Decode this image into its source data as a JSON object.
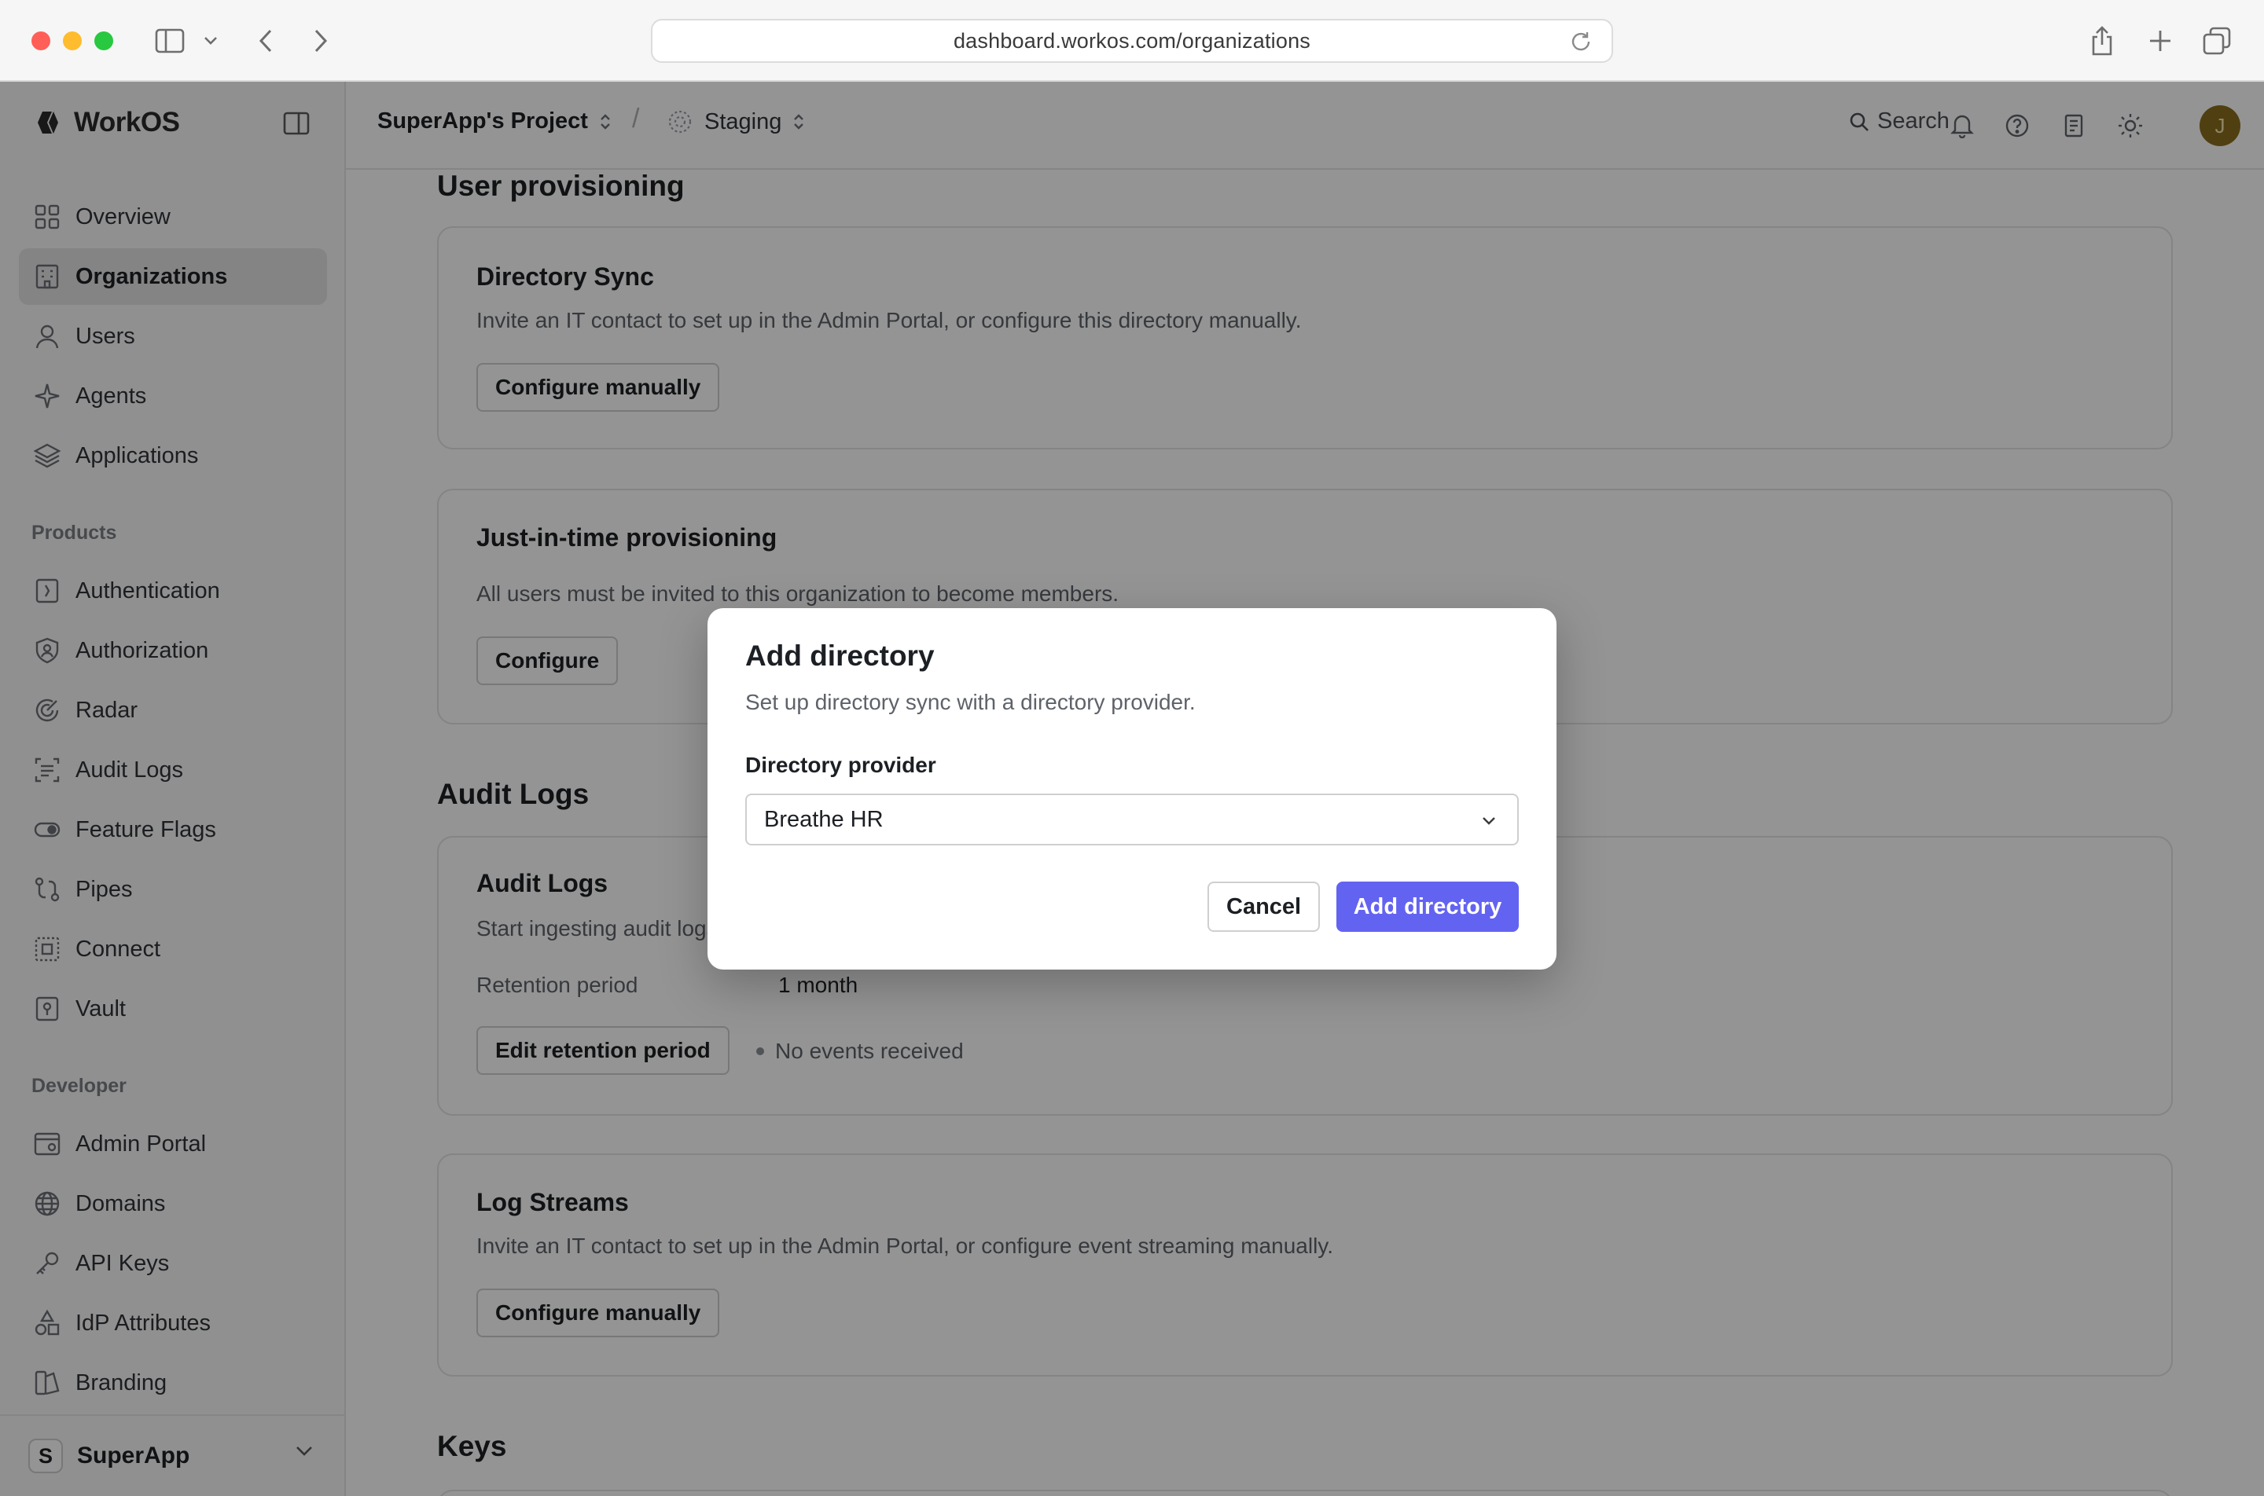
{
  "browser": {
    "url": "dashboard.workos.com/organizations"
  },
  "sidebar": {
    "brand": "WorkOS",
    "items": [
      {
        "label": "Overview",
        "icon": "grid-icon"
      },
      {
        "label": "Organizations",
        "icon": "building-icon",
        "active": true
      },
      {
        "label": "Users",
        "icon": "user-icon"
      },
      {
        "label": "Agents",
        "icon": "sparkle-icon"
      },
      {
        "label": "Applications",
        "icon": "layers-icon"
      }
    ],
    "products_label": "Products",
    "products": [
      {
        "label": "Authentication",
        "icon": "auth-icon"
      },
      {
        "label": "Authorization",
        "icon": "shield-icon"
      },
      {
        "label": "Radar",
        "icon": "radar-icon"
      },
      {
        "label": "Audit Logs",
        "icon": "audit-icon"
      },
      {
        "label": "Feature Flags",
        "icon": "toggle-icon"
      },
      {
        "label": "Pipes",
        "icon": "pipes-icon"
      },
      {
        "label": "Connect",
        "icon": "connect-icon"
      },
      {
        "label": "Vault",
        "icon": "vault-icon"
      }
    ],
    "developer_label": "Developer",
    "developer": [
      {
        "label": "Admin Portal",
        "icon": "portal-icon"
      },
      {
        "label": "Domains",
        "icon": "globe-icon"
      },
      {
        "label": "API Keys",
        "icon": "key-icon"
      },
      {
        "label": "IdP Attributes",
        "icon": "shapes-icon"
      },
      {
        "label": "Branding",
        "icon": "brush-icon"
      }
    ],
    "workspace": {
      "initial": "S",
      "name": "SuperApp"
    }
  },
  "header": {
    "project": "SuperApp's Project",
    "separator": "/",
    "environment": "Staging",
    "search_label": "Search",
    "user_initial": "J"
  },
  "main": {
    "user_provisioning_title": "User provisioning",
    "directory_sync": {
      "title": "Directory Sync",
      "desc": "Invite an IT contact to set up in the Admin Portal, or configure this directory manually.",
      "button": "Configure manually"
    },
    "jit": {
      "title": "Just-in-time provisioning",
      "desc": "All users must be invited to this organization to become members.",
      "button": "Configure"
    },
    "audit_logs_title": "Audit Logs",
    "audit_logs": {
      "title": "Audit Logs",
      "desc": "Start ingesting audit logs",
      "retention_label": "Retention period",
      "retention_value": "1 month",
      "button": "Edit retention period",
      "status": "No events received"
    },
    "log_streams": {
      "title": "Log Streams",
      "desc": "Invite an IT contact to set up in the Admin Portal, or configure event streaming manually.",
      "button": "Configure manually"
    },
    "keys_title": "Keys"
  },
  "dialog": {
    "title": "Add directory",
    "desc": "Set up directory sync with a directory provider.",
    "provider_label": "Directory provider",
    "provider_value": "Breathe HR",
    "cancel": "Cancel",
    "submit": "Add directory",
    "primary_color": "#6363f1"
  }
}
